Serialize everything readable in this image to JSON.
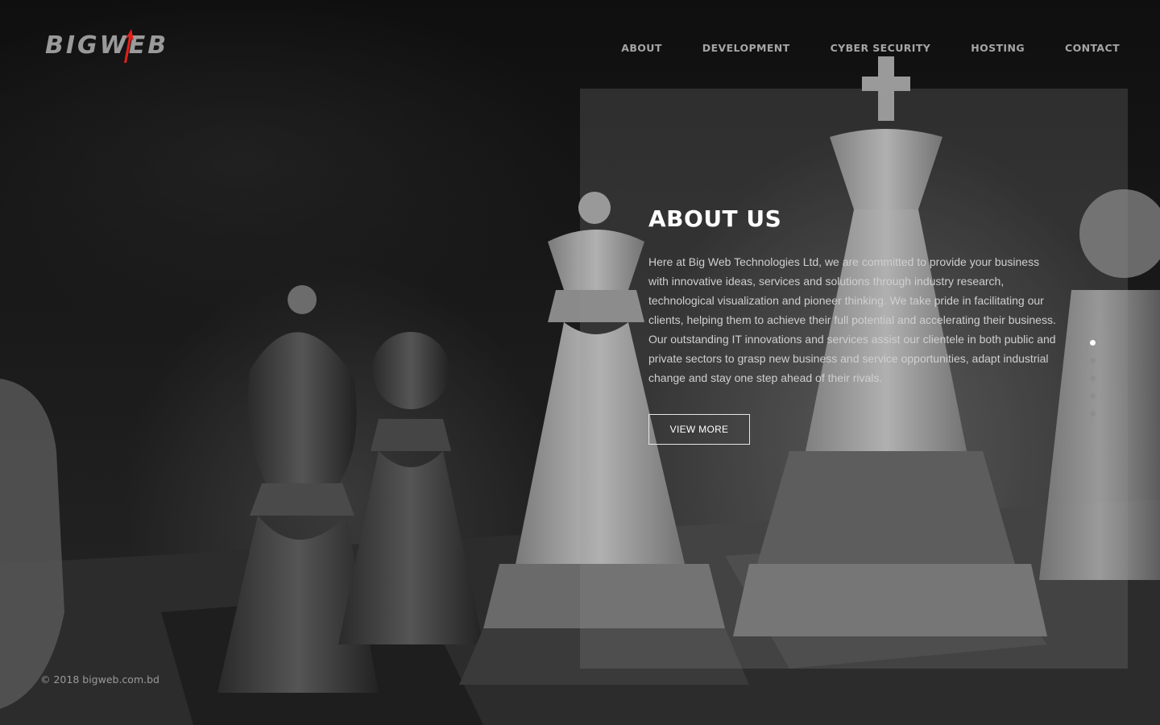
{
  "brand": {
    "logo_text": "BIGWEB",
    "accent_color": "#e0201a"
  },
  "nav": {
    "items": [
      {
        "label": "ABOUT"
      },
      {
        "label": "DEVELOPMENT"
      },
      {
        "label": "CYBER SECURITY"
      },
      {
        "label": "HOSTING"
      },
      {
        "label": "CONTACT"
      }
    ]
  },
  "hero": {
    "title": "ABOUT US",
    "body": "Here at Big Web Technologies Ltd, we are committed to provide your business with innovative ideas, services and solutions through industry research, technological visualization and pioneer thinking. We take pride in facilitating our clients, helping them to achieve their full potential and accelerating their business. Our outstanding IT innovations and services assist our clientele in both public and private sectors to grasp new business and service opportunities, adapt industrial change and stay one step ahead of their rivals.",
    "button_label": "VIEW MORE"
  },
  "slider": {
    "count": 5,
    "active_index": 0
  },
  "footer": {
    "copyright": "© 2018 bigweb.com.bd"
  }
}
